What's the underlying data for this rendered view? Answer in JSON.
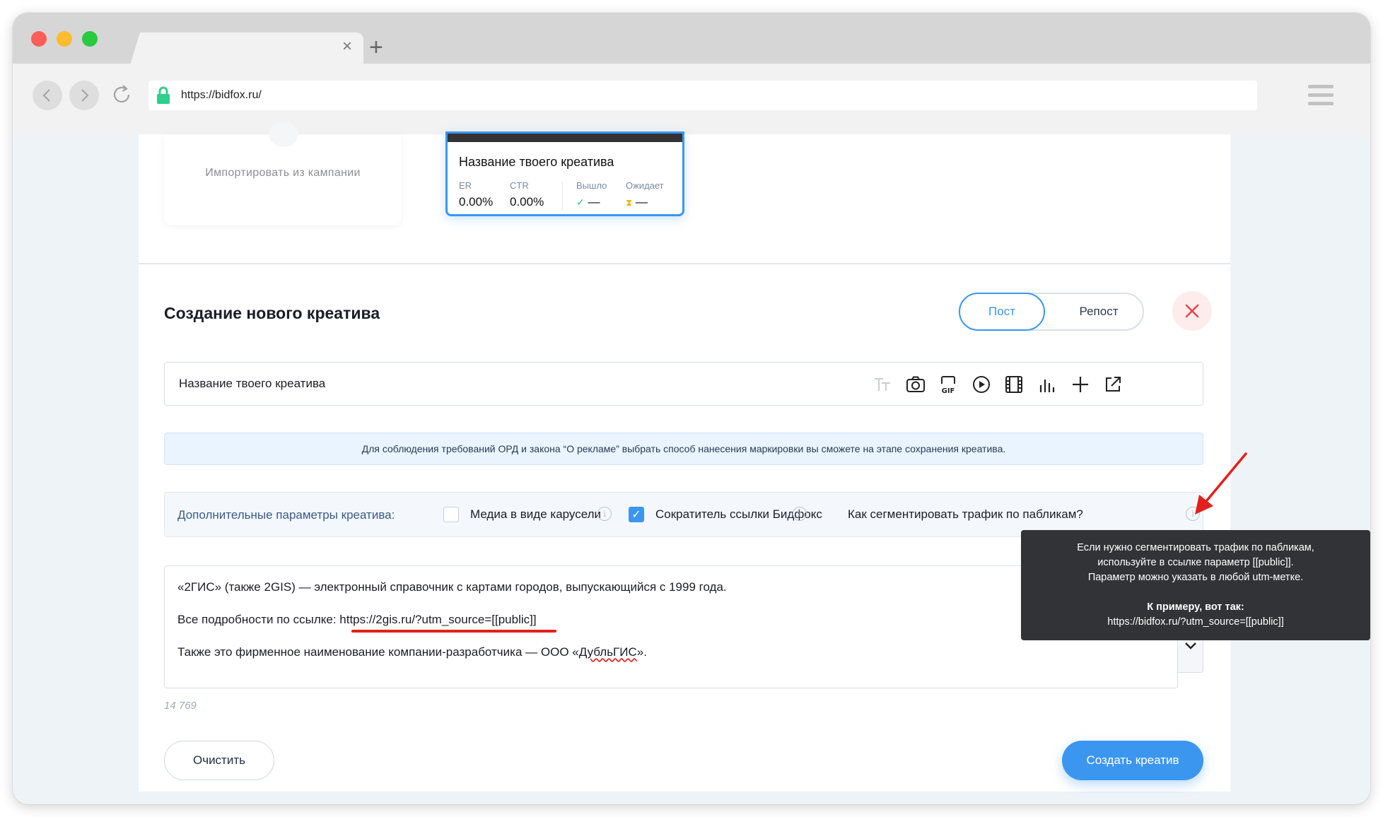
{
  "browser": {
    "url": "https://bidfox.ru/",
    "tab_close": "×",
    "new_tab": "+"
  },
  "import": {
    "label": "Импортировать из кампании"
  },
  "preview": {
    "title": "Название твоего креатива",
    "stats": {
      "er_label": "ER",
      "er_value": "0.00%",
      "ctr_label": "CTR",
      "ctr_value": "0.00%",
      "out_label": "Вышло",
      "out_value": "—",
      "wait_label": "Ожидает",
      "wait_value": "—"
    }
  },
  "form": {
    "heading": "Создание нового креатива",
    "type_options": [
      "Пост",
      "Репост"
    ],
    "selected_type": "Пост",
    "title_value": "Название твоего креатива",
    "toolbar_icons": [
      "text-format-icon",
      "camera-icon",
      "gif-icon",
      "play-icon",
      "film-icon",
      "chart-icon",
      "plus-icon",
      "external-link-icon"
    ],
    "notice": "Для соблюдения требований ОРД и закона “О рекламе” выбрать способ нанесения маркировки вы сможете на этапе сохранения креатива.",
    "params": {
      "label": "Дополнительные параметры креатива:",
      "carousel_label": "Медиа в виде карусели",
      "carousel_checked": false,
      "shortener_label": "Сократитель ссылки Бидфокс",
      "shortener_checked": true,
      "segment_label": "Как сегментировать трафик по пабликам?"
    },
    "body": {
      "line1": "«2ГИС» (также 2GIS) — электронный справочник с картами городов, выпускающийся с 1999 года.",
      "line2_prefix": "Все подробности по ссылке: ",
      "line2_link": "https://2gis.ru/?utm_source=[[public]]",
      "line3_prefix": "Также это фирменное наименование компании-разработчика — ООО «",
      "line3_spell": "ДубльГИС",
      "line3_suffix": "»."
    },
    "char_count": "14 769",
    "clear_label": "Очистить",
    "create_label": "Создать креатив"
  },
  "tooltip": {
    "line1": "Если нужно сегментировать трафик по пабликам,",
    "line2": "используйте в ссылке параметр [[public]].",
    "line3": "Параметр можно указать в любой utm-метке.",
    "example_label": "К примеру, вот так:",
    "example_url": "https://bidfox.ru/?utm_source=[[public]]"
  },
  "colors": {
    "accent": "#3b96f0",
    "close_red": "#e5484d",
    "tooltip_bg": "#323337",
    "annotation_red": "#e3201b"
  }
}
